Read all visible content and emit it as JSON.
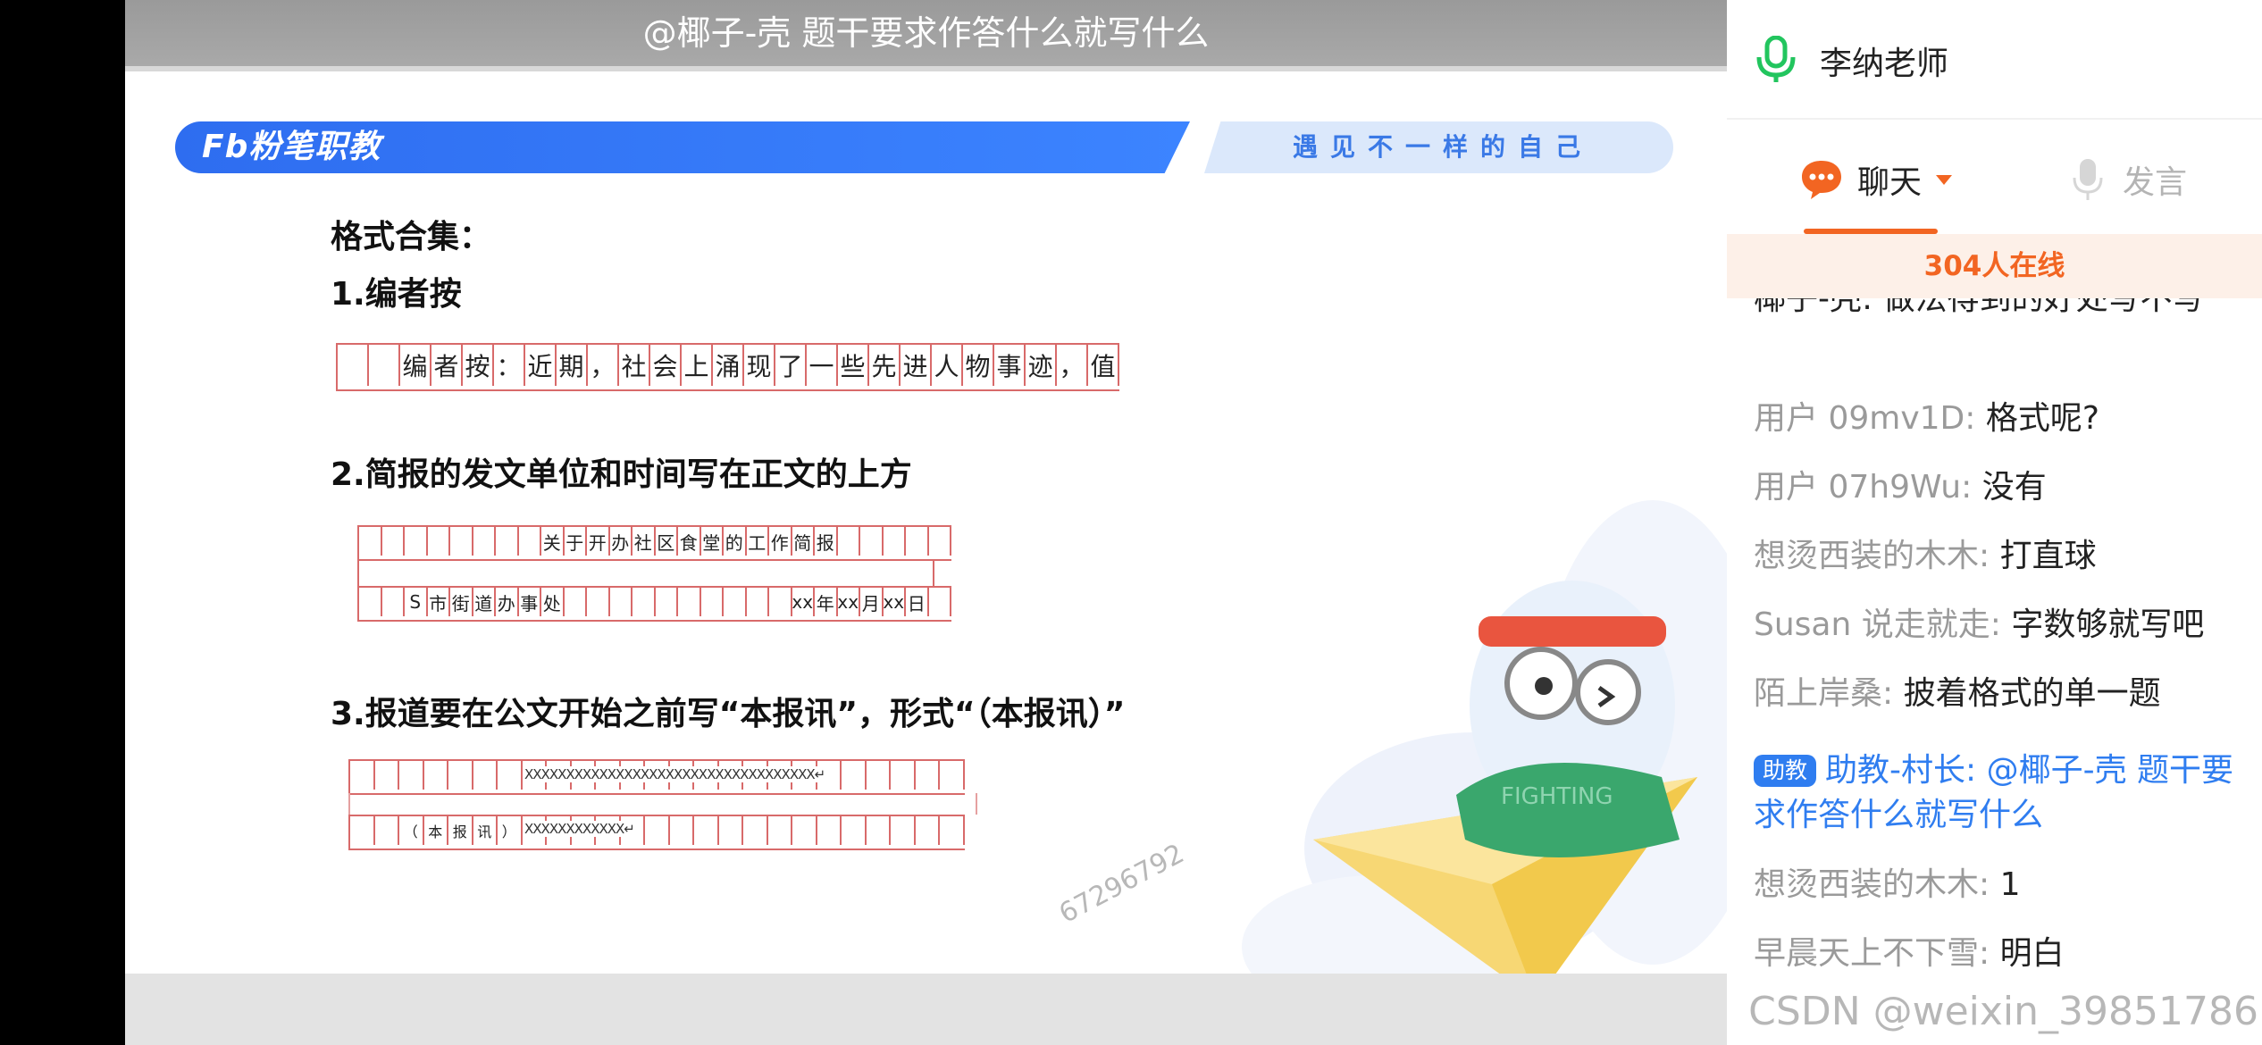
{
  "banner": {
    "text": "@椰子-壳  题干要求作答什么就写什么"
  },
  "brand": {
    "logo": "Fb粉笔职教",
    "slogan": "遇见不一样的自己"
  },
  "slide": {
    "title": "格式合集：",
    "item1": "1.编者按",
    "item1_grid": [
      "",
      "",
      "编",
      "者",
      "按",
      "：",
      "近",
      "期",
      "，",
      "社",
      "会",
      "上",
      "涌",
      "现",
      "了",
      "一",
      "些",
      "先",
      "进",
      "人",
      "物",
      "事",
      "迹",
      "，",
      "值"
    ],
    "item2": "2.简报的发文单位和时间写在正文的上方",
    "item2_grid_row1": [
      "",
      "",
      "",
      "",
      "",
      "",
      "",
      "",
      "关",
      "于",
      "开",
      "办",
      "社",
      "区",
      "食",
      "堂",
      "的",
      "工",
      "作",
      "简",
      "报",
      "",
      "",
      "",
      "",
      ""
    ],
    "item2_grid_row2": [
      "",
      "",
      "S",
      "市",
      "街",
      "道",
      "办",
      "事",
      "处",
      "",
      "",
      "",
      "",
      "",
      "",
      "",
      "",
      "",
      "",
      "xxxx",
      "年",
      "xx",
      "月",
      "xx",
      "日",
      ""
    ],
    "item3": "3.报道要在公文开始之前写“本报讯”，形式“（本报讯）”",
    "item3_row1_fill": "XXXXXXXXXXXXXXXXXXXXXXXXXXXXXXXXXXX↵",
    "item3_row2_labels": [
      "（",
      "本",
      "报",
      "讯",
      "）"
    ],
    "item3_row2_fill": "XXXXXXXXXXXX↵",
    "watermark_number": "67296792",
    "mascot_text": "FIGHTING"
  },
  "panel": {
    "teacher_name": "李纳老师",
    "tab_chat": "聊天",
    "tab_speak": "发言",
    "online_count": "304人在线",
    "partial_message": "椰子-壳: 做法得到的好处写不写",
    "messages": [
      {
        "name": "用户 09mv1D:",
        "text": "格式呢?"
      },
      {
        "name": "用户 07h9Wu:",
        "text": "没有"
      },
      {
        "name": "想烫西装的木木:",
        "text": "打直球"
      },
      {
        "name": "Susan 说走就走:",
        "text": "字数够就写吧"
      },
      {
        "name": "陌上岸桑:",
        "text": "披着格式的单一题"
      }
    ],
    "assistant_message": {
      "badge": "助教",
      "name": "助教-村长:",
      "text": "@椰子-壳  题干要求作答什么就写什么"
    },
    "messages_after": [
      {
        "name": "想烫西装的木木:",
        "text": "1"
      },
      {
        "name": "早晨天上不下雪:",
        "text": "明白"
      }
    ]
  },
  "watermark": {
    "csdn": "CSDN @weixin_39851786"
  },
  "colors": {
    "accent_orange": "#f26522",
    "brand_blue": "#3c84ff",
    "assistant_blue": "#2f7df0",
    "mic_green": "#22c55e",
    "grid_red": "#d86a6a"
  }
}
